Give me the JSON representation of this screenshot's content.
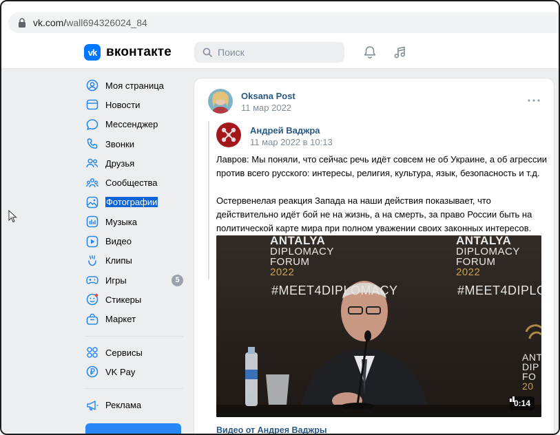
{
  "browser": {
    "url_host": "vk.com/",
    "url_path": "wall694326024_84"
  },
  "header": {
    "logo_mark": "vk",
    "logo_text": "вконтакте",
    "search_placeholder": "Поиск",
    "icons": [
      "bell-icon",
      "music-note-icon"
    ]
  },
  "sidebar": {
    "items": [
      {
        "label": "Моя страница",
        "icon": "profile-icon"
      },
      {
        "label": "Новости",
        "icon": "news-icon"
      },
      {
        "label": "Мессенджер",
        "icon": "messenger-icon"
      },
      {
        "label": "Звонки",
        "icon": "phone-icon"
      },
      {
        "label": "Друзья",
        "icon": "friends-icon"
      },
      {
        "label": "Сообщества",
        "icon": "communities-icon"
      },
      {
        "label": "Фотографии",
        "icon": "photos-icon",
        "selected": true
      },
      {
        "label": "Музыка",
        "icon": "music-icon"
      },
      {
        "label": "Видео",
        "icon": "video-icon"
      },
      {
        "label": "Клипы",
        "icon": "clips-icon"
      },
      {
        "label": "Игры",
        "icon": "games-icon",
        "badge": "5"
      },
      {
        "label": "Стикеры",
        "icon": "stickers-icon"
      },
      {
        "label": "Маркет",
        "icon": "market-icon"
      }
    ],
    "items2": [
      {
        "label": "Сервисы",
        "icon": "services-icon"
      },
      {
        "label": "VK Pay",
        "icon": "vkpay-icon"
      }
    ],
    "items3": [
      {
        "label": "Реклама",
        "icon": "ads-icon"
      }
    ]
  },
  "post": {
    "author": "Oksana Post",
    "date": "11 мар 2022",
    "repost": {
      "author": "Андрей Ваджра",
      "date": "11 мар 2022 в 10:13",
      "paragraph1": "Лавров: Мы поняли, что сейчас речь идёт совсем не об Украине, а об агрессии против всего русского: интересы, религия, культура, язык, безопасность и т.д.",
      "paragraph2": "Остервенелая реакция Запада на наши действия показывает, что действительно идёт бой не на жизнь, а на смерть, за право России быть на политической карте мира при полном уважении своих законных интересов."
    },
    "video": {
      "forum_line1": "ANTALYA",
      "forum_line2": "DIPLOMACY",
      "forum_line3": "FORUM",
      "forum_year": "2022",
      "hashtag": "#MEET4DIPLOMACY",
      "duration": "0:14",
      "title": "Видео от Андрея Ваджры"
    }
  },
  "colors": {
    "accent": "#0077ff",
    "link": "#2a5885",
    "selection": "#0a64d6",
    "page_bg": "#edeef0"
  }
}
